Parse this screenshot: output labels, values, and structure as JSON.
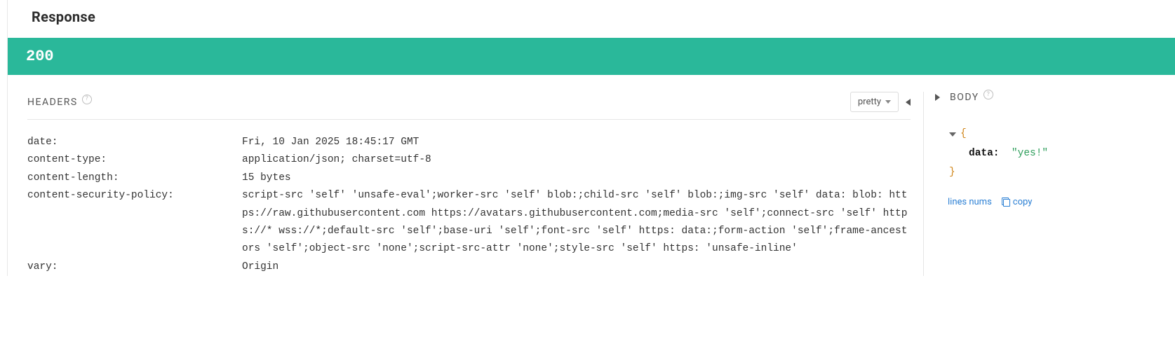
{
  "title": "Response",
  "status_code": "200",
  "headers_section": {
    "label": "HEADERS",
    "view_mode": "pretty"
  },
  "headers": [
    {
      "key": "date:",
      "value": "Fri, 10 Jan 2025 18:45:17 GMT"
    },
    {
      "key": "content-type:",
      "value": "application/json; charset=utf-8"
    },
    {
      "key": "content-length:",
      "value": "15 bytes"
    },
    {
      "key": "content-security-policy:",
      "value": "script-src 'self' 'unsafe-eval';worker-src 'self' blob:;child-src 'self' blob:;img-src 'self' data: blob: https://raw.githubusercontent.com https://avatars.githubusercontent.com;media-src 'self';connect-src 'self' https://* wss://*;default-src 'self';base-uri 'self';font-src 'self' https: data:;form-action 'self';frame-ancestors 'self';object-src 'none';script-src-attr 'none';style-src 'self' https: 'unsafe-inline'"
    },
    {
      "key": "vary:",
      "value": "Origin"
    }
  ],
  "body_section": {
    "label": "BODY",
    "lines_nums_label": "lines nums",
    "copy_label": "copy"
  },
  "body_json": {
    "brace_open": "{",
    "brace_close": "}",
    "prop_key": "data:",
    "prop_value": "\"yes!\""
  }
}
